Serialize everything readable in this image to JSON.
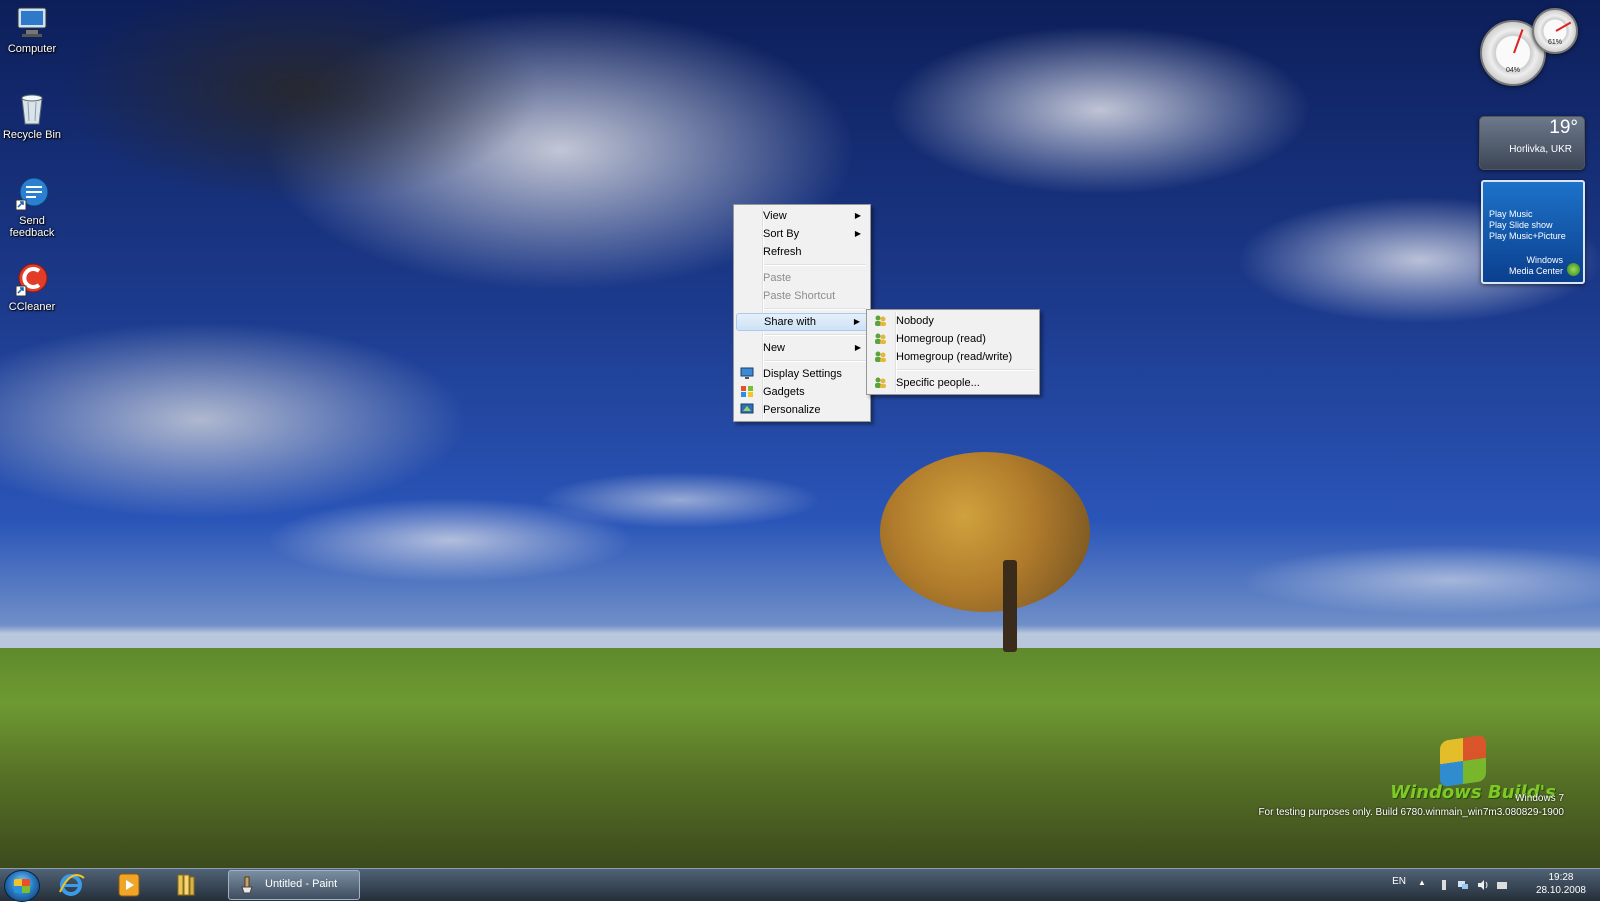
{
  "desktop": {
    "icons": [
      {
        "label": "Computer",
        "icon": "computer-icon"
      },
      {
        "label": "Recycle Bin",
        "icon": "recycle-bin-icon"
      },
      {
        "label": "Send feedback",
        "icon": "send-feedback-icon"
      },
      {
        "label": "CCleaner",
        "icon": "ccleaner-icon"
      }
    ],
    "watermark": {
      "line1": "Windows 7",
      "line2": "For testing purposes only. Build 6780.winmain_win7m3.080829-1900"
    },
    "logo_text": "Windows Build's"
  },
  "gadgets": {
    "meter": {
      "cpu_percent": "04%",
      "mem_percent": "61%"
    },
    "weather": {
      "temperature": "19°",
      "location": "Horlivka, UKR"
    },
    "media_center": {
      "links": [
        "Play Music",
        "Play Slide show",
        "Play Music+Picture"
      ],
      "brand_line1": "Windows",
      "brand_line2": "Media Center"
    }
  },
  "context_menu": {
    "items": [
      {
        "label": "View",
        "submenu": true
      },
      {
        "label": "Sort By",
        "submenu": true
      },
      {
        "label": "Refresh"
      },
      {
        "label": "Paste",
        "disabled": true
      },
      {
        "label": "Paste Shortcut",
        "disabled": true
      },
      {
        "label": "Share with",
        "submenu": true,
        "highlighted": true
      },
      {
        "label": "New",
        "submenu": true
      },
      {
        "label": "Display Settings",
        "icon": "display-settings-icon"
      },
      {
        "label": "Gadgets",
        "icon": "gadgets-icon"
      },
      {
        "label": "Personalize",
        "icon": "personalize-icon"
      }
    ],
    "submenu_share_with": [
      {
        "label": "Nobody",
        "icon": "share-users-icon"
      },
      {
        "label": "Homegroup (read)",
        "icon": "share-users-icon"
      },
      {
        "label": "Homegroup (read/write)",
        "icon": "share-users-icon"
      },
      {
        "label": "Specific people...",
        "icon": "share-users-icon"
      }
    ]
  },
  "taskbar": {
    "pinned": [
      {
        "name": "internet-explorer-icon"
      },
      {
        "name": "media-player-icon"
      },
      {
        "name": "libraries-icon"
      }
    ],
    "active_task": {
      "label": "Untitled - Paint",
      "icon": "paint-icon"
    },
    "tray": {
      "language": "EN",
      "time": "19:28",
      "date": "28.10.2008"
    }
  },
  "colors": {
    "menu_highlight": "#cde2f6",
    "taskbar": "#2a3644"
  }
}
